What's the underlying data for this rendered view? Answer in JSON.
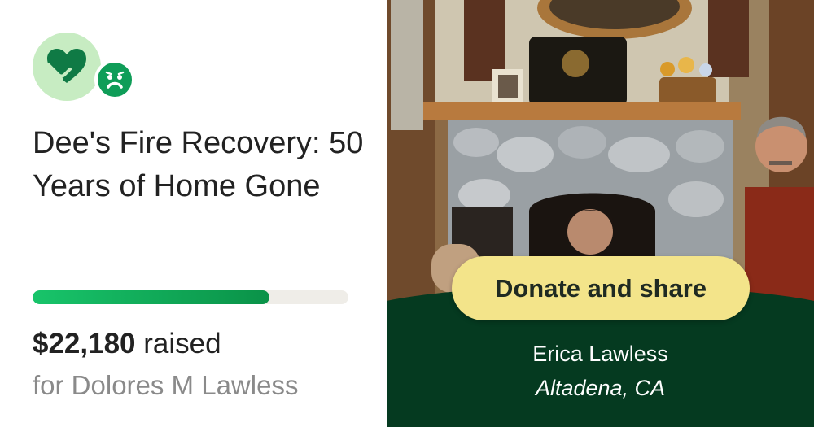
{
  "campaign": {
    "title": "Dee's Fire Recovery: 50 Years of Home Gone",
    "progress_fraction": 0.75,
    "raised_amount": "$22,180",
    "raised_label": "raised",
    "beneficiary": "for Dolores M Lawless"
  },
  "photo_card": {
    "donate_button_label": "Donate and share",
    "organizer_name": "Erica Lawless",
    "organizer_location": "Altadena, CA"
  },
  "icons": {
    "logo": "heart-hand-icon",
    "badge": "sad-face-icon"
  },
  "colors": {
    "brand_green": "#0f9d58",
    "logo_bg": "#c7ecc2",
    "progress_fill": "#18c46a",
    "panel_green": "#053a20",
    "button_yellow": "#f3e48a"
  }
}
